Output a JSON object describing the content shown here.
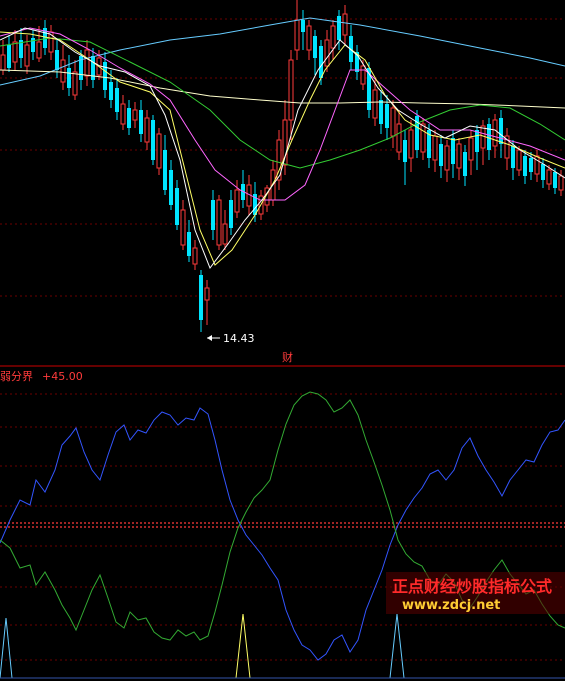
{
  "upper_panel": {
    "min_price_marker": "14.43",
    "event_marker": "财"
  },
  "lower_panel": {
    "header_label": "弱分界",
    "header_value": "+45.00"
  },
  "watermark": {
    "title": "正点财经炒股指标公式",
    "url": "www.zdcj.net"
  },
  "colors": {
    "background": "#000000",
    "up_candle": "#ff3b3b",
    "down_candle": "#00e5ff",
    "ma_white": "#ffffff",
    "ma_yellow": "#ffff66",
    "ma_pink": "#ff66ff",
    "ma_green": "#33cc33",
    "ma_lightblue": "#66ccff",
    "ma_beige": "#ffffcc",
    "blue_line": "#3355ff",
    "green_line": "#33aa33",
    "grid_red": "#8b0000",
    "divider_red": "#ff3b3b",
    "spike_yellow": "#ffff66",
    "spike_cyan": "#66ccff"
  }
}
